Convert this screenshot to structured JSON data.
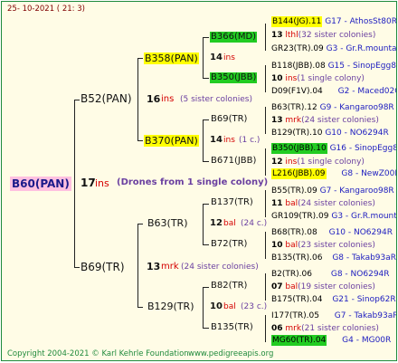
{
  "header": {
    "date": "25- 10-2021 ( 21: 3)"
  },
  "footer": {
    "copyright": "Copyright 2004-2021 © Karl Kehrle Foundation",
    "site": "www.pedigreeapis.org"
  },
  "root": {
    "name": "B60(PAN)",
    "ins_num": "17",
    "ins": "ins",
    "drones": "(Drones from 1 single colony)"
  },
  "g1": {
    "top": {
      "name": "B52(PAN)",
      "num": "16",
      "ins": "ins",
      "note": "(5 sister colonies)"
    },
    "bottom": {
      "name": "B69(TR)",
      "num": "13",
      "ins": "mrk",
      "note": "(24 sister colonies)"
    }
  },
  "g2": {
    "b358": {
      "name": "B358(PAN)",
      "num": "14",
      "ins": "ins",
      "note": ""
    },
    "b370": {
      "name": "B370(PAN)",
      "num": "14",
      "ins": "ins",
      "note": "(1 c.)"
    },
    "b63": {
      "name": "B63(TR)",
      "num": "12",
      "ins": "bal",
      "note": "(24 c.)"
    },
    "b129": {
      "name": "B129(TR)",
      "num": "10",
      "ins": "bal",
      "note": "(23 c.)"
    }
  },
  "g3": {
    "b366": {
      "name": "B366(MD)"
    },
    "b350": {
      "name": "B350(JBB)"
    },
    "b69": {
      "name": "B69(TR)"
    },
    "b671": {
      "name": "B671(JBB)"
    },
    "b137": {
      "name": "B137(TR)"
    },
    "b72": {
      "name": "B72(TR)"
    },
    "b82": {
      "name": "B82(TR)"
    },
    "b135": {
      "name": "B135(TR)"
    }
  },
  "right": [
    {
      "num": "",
      "ins": "",
      "name": "B144(JG).11",
      "code": "G17 - AthosSt80R"
    },
    {
      "num": "13",
      "ins": "lthl",
      "name": "",
      "code": "(32 sister colonies)"
    },
    {
      "num": "",
      "ins": "",
      "name": "GR23(TR).09",
      "code": "G3 - Gr.R.mounta"
    },
    {
      "num": "",
      "ins": "",
      "name": "B118(JBB).08",
      "code": "G15 - SinopEgg86R"
    },
    {
      "num": "10",
      "ins": "ins",
      "name": "",
      "code": "(1 single colony)"
    },
    {
      "num": "",
      "ins": "",
      "name": "D09(F1V).04",
      "code": "G2 - Maced02Q"
    },
    {
      "num": "",
      "ins": "",
      "name": "B63(TR).12",
      "code": "G9 - Kangaroo98R"
    },
    {
      "num": "13",
      "ins": "mrk",
      "name": "",
      "code": "(24 sister colonies)"
    },
    {
      "num": "",
      "ins": "",
      "name": "B129(TR).10",
      "code": "G10 - NO6294R"
    },
    {
      "num": "",
      "ins": "",
      "name": "B350(JBB).10",
      "code": "G16 - SinopEgg86R"
    },
    {
      "num": "12",
      "ins": "ins",
      "name": "",
      "code": "(1 single colony)"
    },
    {
      "num": "",
      "ins": "",
      "name": "L216(JBB).09",
      "code": "G8 - NewZ00R"
    },
    {
      "num": "",
      "ins": "",
      "name": "B55(TR).09",
      "code": "G7 - Kangaroo98R"
    },
    {
      "num": "11",
      "ins": "bal",
      "name": "",
      "code": "(24 sister colonies)"
    },
    {
      "num": "",
      "ins": "",
      "name": "GR109(TR).09",
      "code": "G3 - Gr.R.mounta"
    },
    {
      "num": "",
      "ins": "",
      "name": "B68(TR).08",
      "code": "G10 - NO6294R"
    },
    {
      "num": "10",
      "ins": "bal",
      "name": "",
      "code": "(23 sister colonies)"
    },
    {
      "num": "",
      "ins": "",
      "name": "B135(TR).06",
      "code": "G8 - Takab93aR"
    },
    {
      "num": "",
      "ins": "",
      "name": "B2(TR).06",
      "code": "G8 - NO6294R"
    },
    {
      "num": "07",
      "ins": "bal",
      "name": "",
      "code": "(19 sister colonies)"
    },
    {
      "num": "",
      "ins": "",
      "name": "B175(TR).04",
      "code": "G21 - Sinop62R"
    },
    {
      "num": "",
      "ins": "",
      "name": "I177(TR).05",
      "code": "G7 - Takab93aR"
    },
    {
      "num": "06",
      "ins": "mrk",
      "name": "",
      "code": "(21 sister colonies)"
    },
    {
      "num": "",
      "ins": "",
      "name": "MG60(TR).04",
      "code": "G4 - MG00R"
    }
  ]
}
